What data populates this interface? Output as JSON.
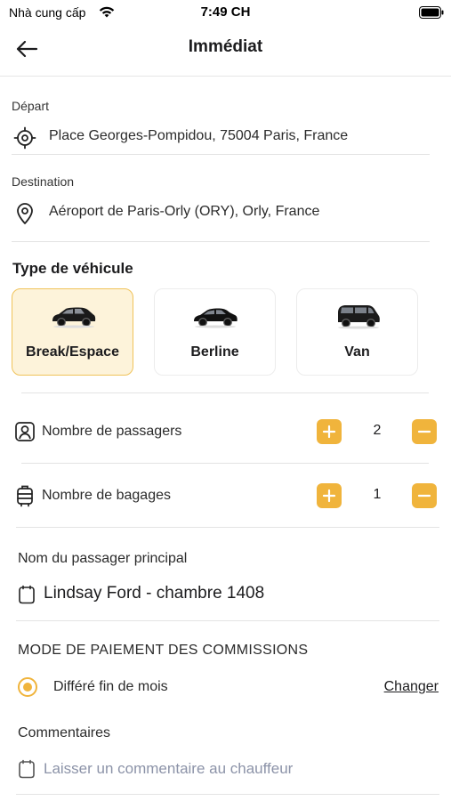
{
  "status_bar": {
    "carrier": "Nhà cung cấp",
    "time": "7:49 CH"
  },
  "header": {
    "title": "Immédiat"
  },
  "departure": {
    "label": "Départ",
    "address": "Place Georges-Pompidou, 75004 Paris, France"
  },
  "destination": {
    "label": "Destination",
    "address": "Aéroport de Paris-Orly (ORY), Orly, France"
  },
  "vehicle_type": {
    "title": "Type de véhicule",
    "options": [
      {
        "label": "Break/Espace",
        "selected": true
      },
      {
        "label": "Berline",
        "selected": false
      },
      {
        "label": "Van",
        "selected": false
      }
    ]
  },
  "passengers": {
    "label": "Nombre de passagers",
    "value": "2"
  },
  "luggage": {
    "label": "Nombre de bagages",
    "value": "1"
  },
  "main_passenger": {
    "label": "Nom du passager principal",
    "value": "Lindsay Ford - chambre 1408"
  },
  "payment": {
    "title": "MODE DE PAIEMENT DES COMMISSIONS",
    "value": "Différé fin de mois",
    "change_label": "Changer"
  },
  "comments": {
    "label": "Commentaires",
    "placeholder": "Laisser un commentaire au chauffeur"
  },
  "colors": {
    "accent": "#f0b43c",
    "selected_bg": "#fdf3da",
    "placeholder": "#8c93a8"
  },
  "icons": {
    "back": "arrow-left-icon",
    "departure": "crosshair-icon",
    "destination": "map-pin-icon",
    "passengers": "user-icon",
    "luggage": "suitcase-icon",
    "name": "note-icon",
    "comment": "note-icon",
    "plus": "plus-icon",
    "minus": "minus-icon"
  }
}
